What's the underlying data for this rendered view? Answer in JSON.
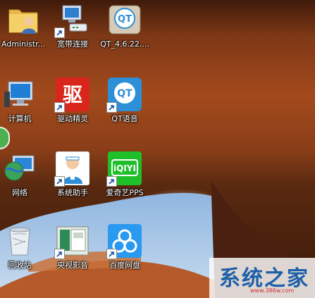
{
  "desktop": {
    "icons": [
      {
        "id": "administrator",
        "label": "Administr..."
      },
      {
        "id": "broadband",
        "label": "宽带连接"
      },
      {
        "id": "qt-installer",
        "label": "QT_4.6.22...."
      },
      {
        "id": "computer",
        "label": "计算机"
      },
      {
        "id": "driver-genius",
        "label": "驱动精灵"
      },
      {
        "id": "qt-voice",
        "label": "QT语音"
      },
      {
        "id": "network",
        "label": "网络"
      },
      {
        "id": "system-assistant",
        "label": "系统助手"
      },
      {
        "id": "iqiyi",
        "label": "爱奇艺PPS"
      },
      {
        "id": "recycle-bin",
        "label": "回收站"
      },
      {
        "id": "cctv-video",
        "label": "央视影音"
      },
      {
        "id": "baidu-pan",
        "label": "百度网盘"
      }
    ],
    "glyphs": {
      "qt": "QT",
      "driver": "驱",
      "iqiyi": "iQIYI"
    }
  },
  "watermark": {
    "text": "系统之家",
    "url": "www.386w.com"
  },
  "colors": {
    "qt_blue": "#2d8fd8",
    "driver_red": "#d9261c",
    "iqiyi_green": "#1fbf2a",
    "baidu_blue": "#2a9af0"
  }
}
